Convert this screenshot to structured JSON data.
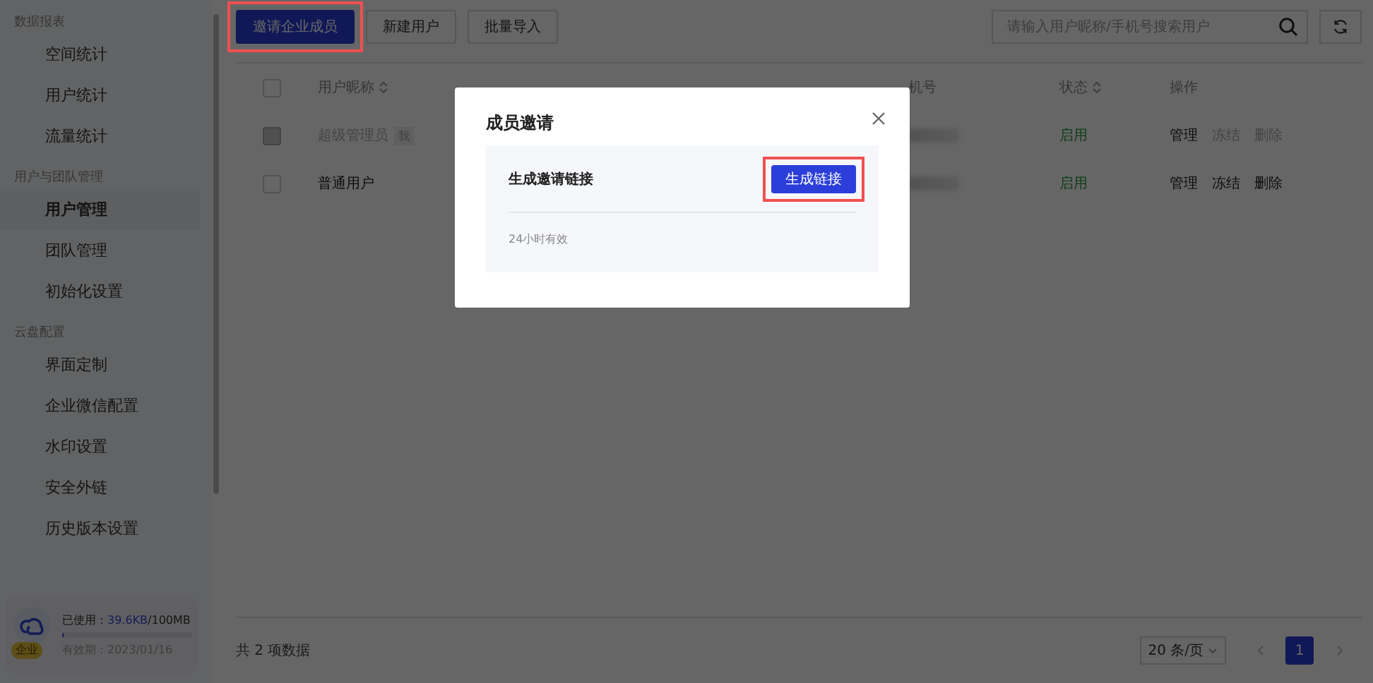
{
  "sidebar": {
    "groups": [
      {
        "label": "数据报表",
        "items": [
          {
            "label": "空间统计",
            "selected": false
          },
          {
            "label": "用户统计",
            "selected": false
          },
          {
            "label": "流量统计",
            "selected": false
          }
        ]
      },
      {
        "label": "用户与团队管理",
        "items": [
          {
            "label": "用户管理",
            "selected": true
          },
          {
            "label": "团队管理",
            "selected": false
          },
          {
            "label": "初始化设置",
            "selected": false
          }
        ]
      },
      {
        "label": "云盘配置",
        "items": [
          {
            "label": "界面定制",
            "selected": false
          },
          {
            "label": "企业微信配置",
            "selected": false
          },
          {
            "label": "水印设置",
            "selected": false
          },
          {
            "label": "安全外链",
            "selected": false
          },
          {
            "label": "历史版本设置",
            "selected": false
          }
        ]
      }
    ],
    "storage": {
      "badge": "企业",
      "used_label": "已使用：",
      "used": "39.6KB",
      "total": "/100MB",
      "level": 0.01,
      "expiry": "有效期：2023/01/16"
    }
  },
  "toolbar": {
    "buttons": [
      {
        "label": "邀请企业成员",
        "kind": "primary",
        "highlighted": true
      },
      {
        "label": "新建用户",
        "kind": "default"
      },
      {
        "label": "批量导入",
        "kind": "default"
      }
    ],
    "search": {
      "placeholder": "请输入用户昵称/手机号搜索用户"
    }
  },
  "table": {
    "select_all_checked": false,
    "columns": [
      {
        "label": "用户昵称",
        "sortable": true
      },
      {
        "label": "机号"
      },
      {
        "label": "状态",
        "sortable": true
      },
      {
        "label": "操作"
      }
    ],
    "rows": [
      {
        "name": "超级管理员",
        "tag": "我",
        "checked": false,
        "disabled": true,
        "status": "启用",
        "actions": [
          {
            "label": "管理",
            "disabled": false
          },
          {
            "label": "冻结",
            "disabled": true
          },
          {
            "label": "删除",
            "disabled": true
          }
        ]
      },
      {
        "name": "普通用户",
        "checked": false,
        "disabled": false,
        "status": "启用",
        "actions": [
          {
            "label": "管理",
            "disabled": false
          },
          {
            "label": "冻结",
            "disabled": false
          },
          {
            "label": "删除",
            "disabled": false
          }
        ]
      }
    ]
  },
  "footer": {
    "total": "共 2 项数据",
    "page_size": "20 条/页",
    "pages": [
      {
        "label": "1",
        "selected": true
      }
    ]
  },
  "modal": {
    "title": "成员邀请",
    "section_title": "生成邀请链接",
    "button": {
      "label": "生成链接",
      "highlighted": true
    },
    "note": "24小时有效"
  }
}
